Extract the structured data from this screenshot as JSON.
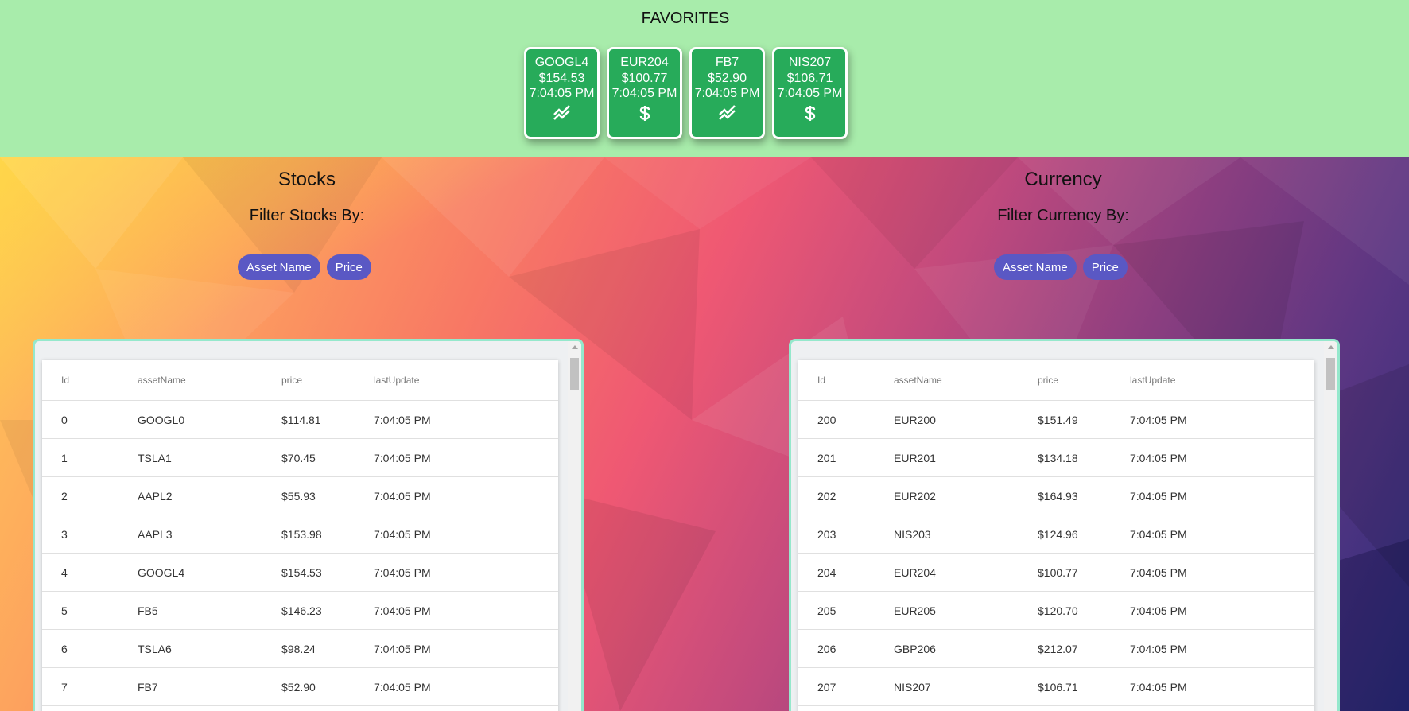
{
  "favorites": {
    "title": "FAVORITES",
    "cards": [
      {
        "name": "GOOGL4",
        "price": "$154.53",
        "time": "7:04:05 PM",
        "icon": "stock-trend-icon"
      },
      {
        "name": "EUR204",
        "price": "$100.77",
        "time": "7:04:05 PM",
        "icon": "dollar-icon"
      },
      {
        "name": "FB7",
        "price": "$52.90",
        "time": "7:04:05 PM",
        "icon": "stock-trend-icon"
      },
      {
        "name": "NIS207",
        "price": "$106.71",
        "time": "7:04:05 PM",
        "icon": "dollar-icon"
      }
    ]
  },
  "stocks": {
    "title": "Stocks",
    "filter_label": "Filter Stocks By:",
    "chips": [
      "Asset Name",
      "Price"
    ],
    "columns": [
      "Id",
      "assetName",
      "price",
      "lastUpdate"
    ],
    "rows": [
      [
        "0",
        "GOOGL0",
        "$114.81",
        "7:04:05 PM"
      ],
      [
        "1",
        "TSLA1",
        "$70.45",
        "7:04:05 PM"
      ],
      [
        "2",
        "AAPL2",
        "$55.93",
        "7:04:05 PM"
      ],
      [
        "3",
        "AAPL3",
        "$153.98",
        "7:04:05 PM"
      ],
      [
        "4",
        "GOOGL4",
        "$154.53",
        "7:04:05 PM"
      ],
      [
        "5",
        "FB5",
        "$146.23",
        "7:04:05 PM"
      ],
      [
        "6",
        "TSLA6",
        "$98.24",
        "7:04:05 PM"
      ],
      [
        "7",
        "FB7",
        "$52.90",
        "7:04:05 PM"
      ]
    ]
  },
  "currency": {
    "title": "Currency",
    "filter_label": "Filter Currency By:",
    "chips": [
      "Asset Name",
      "Price"
    ],
    "columns": [
      "Id",
      "assetName",
      "price",
      "lastUpdate"
    ],
    "rows": [
      [
        "200",
        "EUR200",
        "$151.49",
        "7:04:05 PM"
      ],
      [
        "201",
        "EUR201",
        "$134.18",
        "7:04:05 PM"
      ],
      [
        "202",
        "EUR202",
        "$164.93",
        "7:04:05 PM"
      ],
      [
        "203",
        "NIS203",
        "$124.96",
        "7:04:05 PM"
      ],
      [
        "204",
        "EUR204",
        "$100.77",
        "7:04:05 PM"
      ],
      [
        "205",
        "EUR205",
        "$120.70",
        "7:04:05 PM"
      ],
      [
        "206",
        "GBP206",
        "$212.07",
        "7:04:05 PM"
      ],
      [
        "207",
        "NIS207",
        "$106.71",
        "7:04:05 PM"
      ]
    ]
  },
  "colors": {
    "favorites_bg": "#a8ecab",
    "card_bg": "#27ab5a",
    "chip_bg": "#5a58c4",
    "grid_border": "#95e8cc"
  }
}
